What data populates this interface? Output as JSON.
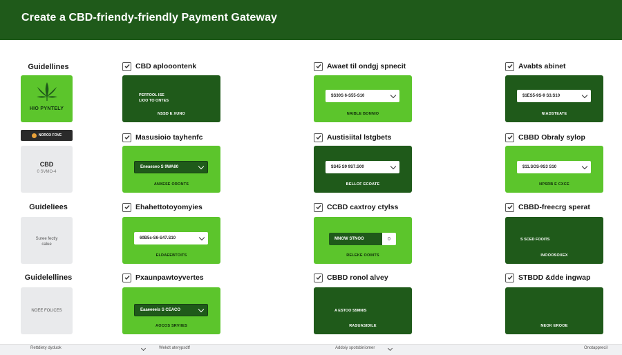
{
  "header": {
    "title": "Create  a CBD-friendy-friendly Payment Gateway"
  },
  "sidebar": {
    "labels": [
      "Guidellines",
      "Guideliees",
      "Guidelellines"
    ],
    "logo_text": "HIO PYNTELY",
    "badge_text": "NOROX FOVE",
    "box1": {
      "title": "CBD",
      "sub": "0 SVMO-4"
    },
    "box2": {
      "line1": "Suree fectly",
      "line2": "calue"
    },
    "box3": {
      "text": "NOEE FOLICES"
    }
  },
  "grid": {
    "col1": [
      {
        "label": "CBD aplooontenk",
        "line1": "PERTOOL ISE",
        "line2": "LIOO TO ONTES",
        "caption": "NSSD E XUNO"
      },
      {
        "label": "Masusioio tayhenfc",
        "select": "Eneaeseo S 9WA80",
        "caption": "ANXESE ORONTS"
      },
      {
        "label": "Ehahettotoyomyies",
        "select": "60B5s-S6-S47.S10",
        "caption": "ELDAEEBTOITS"
      },
      {
        "label": "Pxaunpawtoyvertes",
        "select": "Eaaeeeeis S CEACO",
        "caption": "AOCOS SRVIIES"
      }
    ],
    "col2": [
      {
        "label": "Awaet til ondgj spnecit",
        "select": "$S30S 6-S55-S10",
        "caption": "NAIBLE BONNIO"
      },
      {
        "label": "Austisiital lstgbets",
        "select": "$S45 S9 9S7.S00",
        "caption": "BELLOF ECOATE"
      },
      {
        "label": "CCBD caxtroy ctylss",
        "split_left": "MNOW STNOO",
        "split_right": "0",
        "caption": "RELEKE OOINTS"
      },
      {
        "label": "CBBD ronol alvey",
        "line1": "A ESTOO S5MNIS",
        "line2": "",
        "caption": "RASUASIDILE"
      }
    ],
    "col3": [
      {
        "label": "Avabts abinet",
        "select": "$1ES5-9S-9 S3.S10",
        "caption": "NIADSTEATE"
      },
      {
        "label": "CBBD Obraly sylop",
        "select": "$11.SOS-9S3 S10",
        "caption": "NPSRB E CXCE"
      },
      {
        "label": "CBBD-freecrg sperat",
        "line1": "S SCED FOOITS",
        "line2": "",
        "caption": "INOOOSOXEX"
      },
      {
        "label": "STBDD &dde ingwap",
        "line1": "",
        "line2": "",
        "caption": "NEOK EROOE"
      }
    ]
  },
  "footer": {
    "items": [
      "Rettdiety dyduok",
      "Wekdt aterypsdtf",
      "Addoiy spotsbiniomer",
      "Onotapprecil"
    ]
  },
  "colors": {
    "dark_green": "#1f5a1a",
    "light_green": "#5cc52c"
  }
}
